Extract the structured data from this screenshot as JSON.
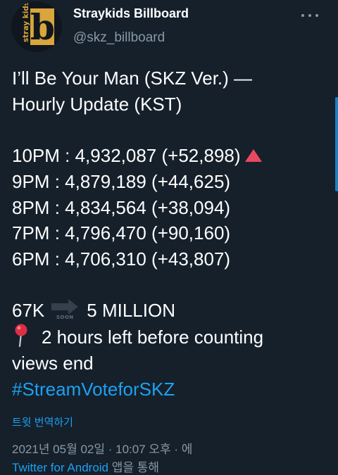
{
  "header": {
    "display_name": "Straykids Billboard",
    "handle": "@skz_billboard",
    "avatar_logo_text": "stray kids",
    "avatar_logo_letter": "b"
  },
  "tweet": {
    "title_line1": "I’ll Be Your Man (SKZ Ver.) —",
    "title_line2": "Hourly Update (KST)",
    "hourly": [
      {
        "time": "10PM",
        "views": "4,932,087",
        "change": "(+52,898)",
        "trend": "up"
      },
      {
        "time": "9PM",
        "views": "4,879,189",
        "change": "(+44,625)"
      },
      {
        "time": "8PM",
        "views": "4,834,564",
        "change": "(+38,094)"
      },
      {
        "time": "7PM",
        "views": "4,796,470",
        "change": "(+90,160)"
      },
      {
        "time": "6PM",
        "views": "4,706,310",
        "change": "(+43,807)"
      }
    ],
    "goal_from": "67K",
    "goal_emoji_label": "SOON",
    "goal_to": "5 MILLION",
    "countdown_line1": "2 hours left before counting",
    "countdown_line2": "views end",
    "hashtag": "#StreamVoteforSKZ"
  },
  "translate_label": "트윗 번역하기",
  "meta": {
    "timestamp": "2021년 05월 02일 · 10:07 오후 · 에",
    "source": "Twitter for Android",
    "source_suffix": " 앱을 통해"
  },
  "colors": {
    "background": "#15202b",
    "text": "#ffffff",
    "secondary": "#8899a6",
    "link": "#1da1f2",
    "trend_up": "#e8495e",
    "avatar_gold": "#d8a63d"
  }
}
